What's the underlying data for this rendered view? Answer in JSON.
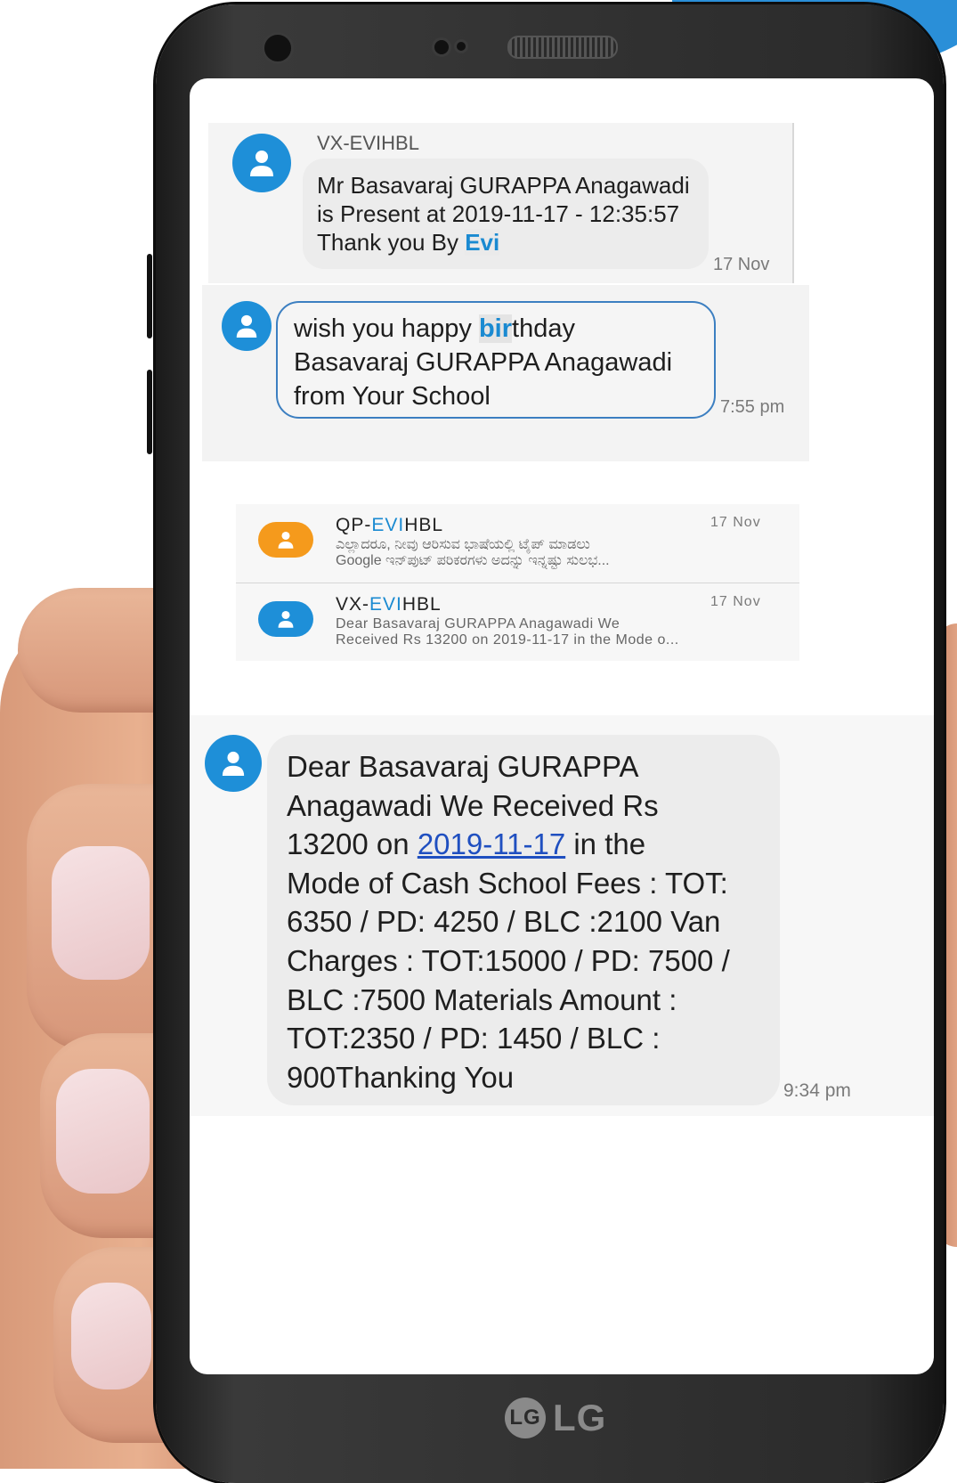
{
  "brand": {
    "logo_text": "LG",
    "logo_mark": "LG"
  },
  "messages": {
    "first": {
      "sender": "VX-EVIHBL",
      "line1": "Mr Basavaraj GURAPPA   Anagawadi",
      "line2": "is Present at 2019-11-17  -  12:35:57",
      "line3_prefix": "Thank you By ",
      "line3_highlight": "Evi",
      "time": "17 Nov"
    },
    "birthday": {
      "line1_prefix": "wish you happy ",
      "line1_highlight": "bir",
      "line1_suffix": "thday",
      "line2": "Basavaraj GURAPPA   Anagawadi",
      "line3": "from Your School",
      "time": "7:55 pm"
    },
    "list": [
      {
        "sender_prefix": "QP-",
        "sender_highlight": "EVI",
        "sender_suffix": "HBL",
        "date": "17 Nov",
        "preview_line1": "ಎಲ್ಲಾದರೂ, ನೀವು ಆರಿಸುವ ಭಾಷೆಯಲ್ಲಿ ಟೈಪ್ ಮಾಡಲು",
        "preview_line2": "Google ಇನ್‌ಪುಟ್ ಪರಿಕರಗಳು ಅದನ್ನು ಇನ್ನಷ್ಟು ಸುಲಭ..."
      },
      {
        "sender_prefix": "VX-",
        "sender_highlight": "EVI",
        "sender_suffix": "HBL",
        "date": "17 Nov",
        "preview_line1": "Dear Basavaraj GURAPPA   Anagawadi We",
        "preview_line2": "Received Rs 13200 on 2019-11-17 in the Mode o..."
      }
    ],
    "fees": {
      "line1": "Dear Basavaraj GURAPPA",
      "line2": "Anagawadi We Received Rs",
      "line3_prefix": "13200 on ",
      "line3_link": "2019-11-17",
      "line3_suffix": " in the",
      "line4": "Mode of Cash School Fees : TOT:",
      "line5": "6350 / PD: 4250 / BLC :2100 Van",
      "line6": "Charges : TOT:15000 / PD: 7500 /",
      "line7": "BLC :7500 Materials Amount :",
      "line8": "TOT:2350 / PD: 1450 / BLC :",
      "line9": "900Thanking You",
      "time": "9:34 pm"
    }
  },
  "colors": {
    "accent": "#1a8ad1",
    "avatar_blue": "#1e8fd8",
    "avatar_orange": "#f59a1c"
  },
  "icons": {
    "avatar": "person-icon"
  }
}
